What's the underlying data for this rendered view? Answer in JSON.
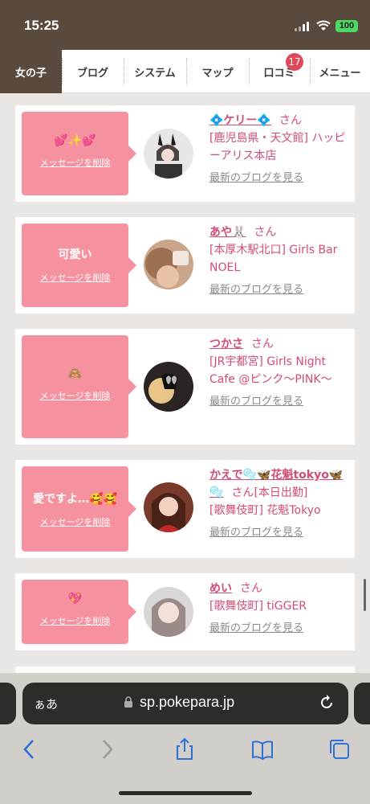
{
  "status": {
    "time": "15:25",
    "battery": "100"
  },
  "nav": {
    "tabs": [
      {
        "label": "女の子"
      },
      {
        "label": "ブログ"
      },
      {
        "label": "システム"
      },
      {
        "label": "マップ"
      },
      {
        "label": "口コミ",
        "badge": "17"
      },
      {
        "label": "メニュー"
      }
    ]
  },
  "cards": [
    {
      "message": "💕✨💕",
      "delete_label": "メッセージを削除",
      "name": "💠ケリー💠",
      "san": "さん",
      "shop": "[鹿児島県・天文館] ハッピーアリス本店",
      "blog_link": "最新のブログを見る"
    },
    {
      "message": "可愛い",
      "delete_label": "メッセージを削除",
      "name": "あや🐰",
      "san": "さん",
      "shop": "[本厚木駅北口] Girls Bar NOEL",
      "blog_link": "最新のブログを見る"
    },
    {
      "message": "🙈",
      "delete_label": "メッセージを削除",
      "name": "つかさ",
      "san": "さん",
      "shop": "[JR宇都宮] Girls Night Cafe @ピンク〜PINK〜",
      "blog_link": "最新のブログを見る"
    },
    {
      "message": "愛ですよ…🥰🥰",
      "delete_label": "メッセージを削除",
      "name": "かえで🫧🦋花魁tokyo🦋🫧",
      "san": "さん",
      "extra": "[本日出勤]",
      "shop": "[歌舞伎町] 花魁Tokyo",
      "blog_link": "最新のブログを見る"
    },
    {
      "message": "💖",
      "delete_label": "メッセージを削除",
      "name": "めい",
      "san": "さん",
      "shop": "[歌舞伎町] tiGGER",
      "blog_link": "最新のブログを見る"
    }
  ],
  "browser": {
    "aa_label": "ぁあ",
    "url": "sp.pokepara.jp"
  }
}
